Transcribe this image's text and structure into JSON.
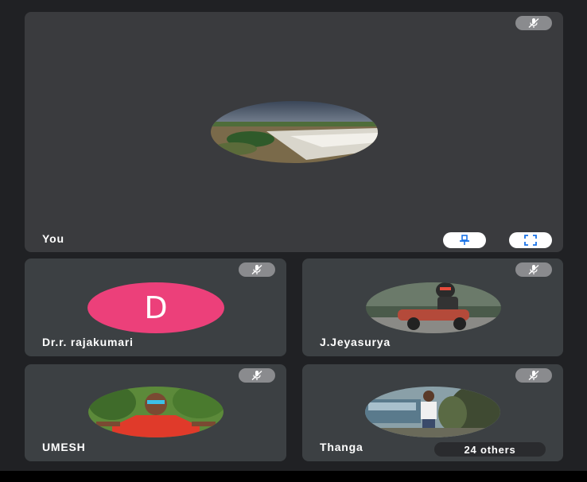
{
  "colors": {
    "background": "#202124",
    "tile": "#3c4043",
    "avatar_letter_bg": "#ec407a",
    "control_blue": "#1a73e8"
  },
  "participants": [
    {
      "name": "You",
      "avatar": "photo-landscape",
      "muted": true,
      "is_self": true
    },
    {
      "name": "Dr.r. rajakumari",
      "avatar_letter": "D",
      "muted": true
    },
    {
      "name": "J.Jeyasurya",
      "avatar": "photo-rider",
      "muted": true
    },
    {
      "name": "UMESH",
      "avatar": "photo-person-red-shirt",
      "muted": true
    },
    {
      "name": "Thanga",
      "avatar": "photo-person-outdoors",
      "muted": true
    }
  ],
  "overflow": {
    "label": "24 others"
  },
  "controls": {
    "pin_icon": "pin-icon",
    "fullscreen_icon": "fullscreen-icon",
    "mute_icon": "mic-off-icon"
  }
}
